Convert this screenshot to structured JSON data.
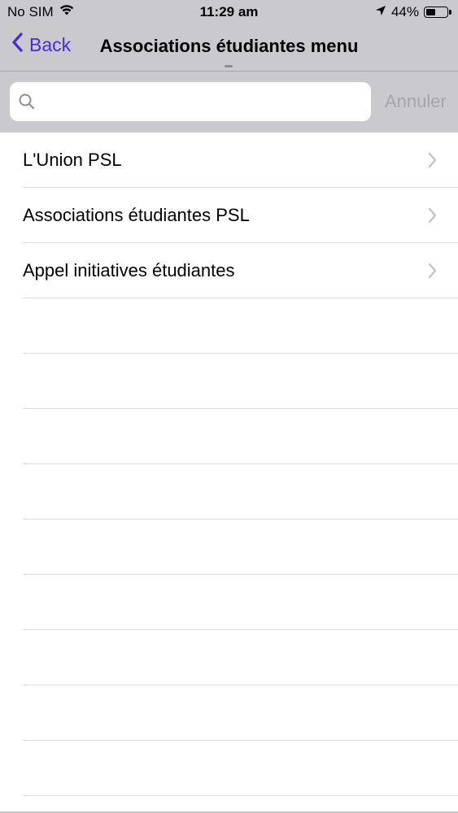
{
  "status_bar": {
    "carrier": "No SIM",
    "time": "11:29 am",
    "battery_percent": "44%",
    "battery_level": 0.44
  },
  "nav": {
    "back_label": "Back",
    "title": "Associations étudiantes menu"
  },
  "search": {
    "placeholder": "",
    "value": "",
    "cancel_label": "Annuler"
  },
  "list": {
    "items": [
      {
        "label": "L'Union PSL"
      },
      {
        "label": "Associations étudiantes PSL"
      },
      {
        "label": "Appel initiatives étudiantes"
      }
    ],
    "empty_rows": 9
  },
  "colors": {
    "accent": "#4b2bd6",
    "header_bg": "#c9c9ce",
    "cancel_text": "#a6a6aa",
    "chevron": "#c4c4c7",
    "separator": "#dedee0"
  }
}
